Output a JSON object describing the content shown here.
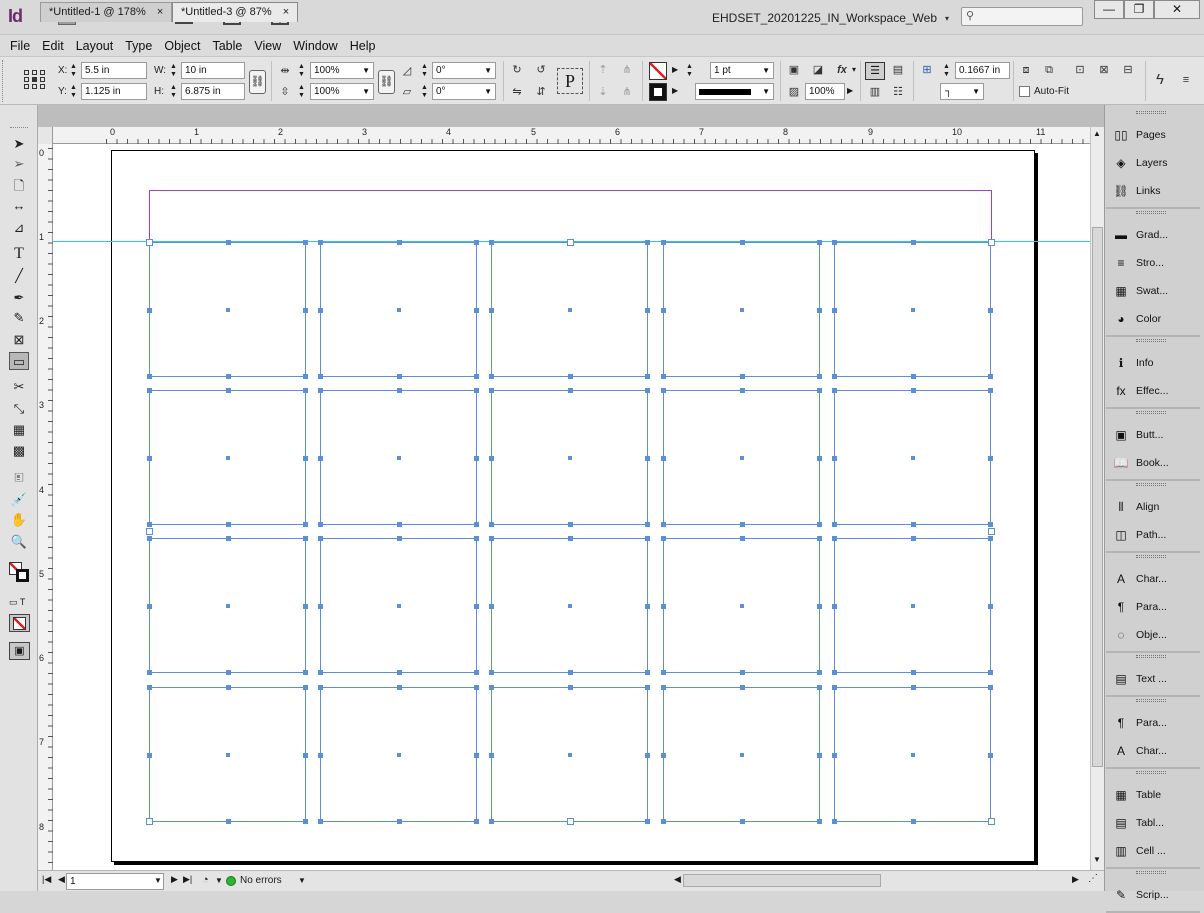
{
  "app": {
    "logo": "Id",
    "bridge": "Br",
    "zoom": "87.8%",
    "workspace": "EHDSET_20201225_IN_Workspace_Web"
  },
  "menu": [
    "File",
    "Edit",
    "Layout",
    "Type",
    "Object",
    "Table",
    "View",
    "Window",
    "Help"
  ],
  "control": {
    "x_label": "X:",
    "x_value": "5.5 in",
    "y_label": "Y:",
    "y_value": "1.125 in",
    "w_label": "W:",
    "w_value": "10 in",
    "h_label": "H:",
    "h_value": "6.875 in",
    "scale_x": "100%",
    "scale_y": "100%",
    "rotate": "0°",
    "shear": "0°",
    "stroke_weight": "1 pt",
    "opacity": "100%",
    "gap": "0.1667 in",
    "autofit_label": "Auto-Fit"
  },
  "tabs": [
    {
      "label": "*Untitled-1 @ 178%",
      "active": false
    },
    {
      "label": "*Untitled-3 @ 87%",
      "active": true
    }
  ],
  "ruler": {
    "h": [
      "0",
      "1",
      "2",
      "3",
      "4",
      "5",
      "6",
      "7",
      "8",
      "9",
      "10",
      "11"
    ],
    "v": [
      "0",
      "1",
      "2",
      "3",
      "4",
      "5",
      "6",
      "7",
      "8"
    ]
  },
  "status": {
    "page": "1",
    "preflight": "No errors"
  },
  "panels": [
    {
      "label": "Pages",
      "icon": "pages-icon"
    },
    {
      "label": "Layers",
      "icon": "layers-icon"
    },
    {
      "label": "Links",
      "icon": "links-icon"
    },
    {
      "label": "Grad...",
      "icon": "gradient-icon"
    },
    {
      "label": "Stro...",
      "icon": "stroke-icon"
    },
    {
      "label": "Swat...",
      "icon": "swatches-icon"
    },
    {
      "label": "Color",
      "icon": "color-icon"
    },
    {
      "label": "Info",
      "icon": "info-icon"
    },
    {
      "label": "Effec...",
      "icon": "effects-icon"
    },
    {
      "label": "Butt...",
      "icon": "buttons-icon"
    },
    {
      "label": "Book...",
      "icon": "bookmarks-icon"
    },
    {
      "label": "Align",
      "icon": "align-icon"
    },
    {
      "label": "Path...",
      "icon": "pathfinder-icon"
    },
    {
      "label": "Char...",
      "icon": "character-styles-icon"
    },
    {
      "label": "Para...",
      "icon": "paragraph-styles-icon"
    },
    {
      "label": "Obje...",
      "icon": "object-styles-icon"
    },
    {
      "label": "Text ...",
      "icon": "text-wrap-icon"
    },
    {
      "label": "Para...",
      "icon": "paragraph-icon"
    },
    {
      "label": "Char...",
      "icon": "character-icon"
    },
    {
      "label": "Table",
      "icon": "table-icon"
    },
    {
      "label": "Tabl...",
      "icon": "table-styles-icon"
    },
    {
      "label": "Cell ...",
      "icon": "cell-styles-icon"
    },
    {
      "label": "Scrip...",
      "icon": "scripts-icon"
    }
  ],
  "colors": {
    "frame": "#5b8fd6",
    "margin": "#b03cc0",
    "guide": "#38c6d6"
  }
}
